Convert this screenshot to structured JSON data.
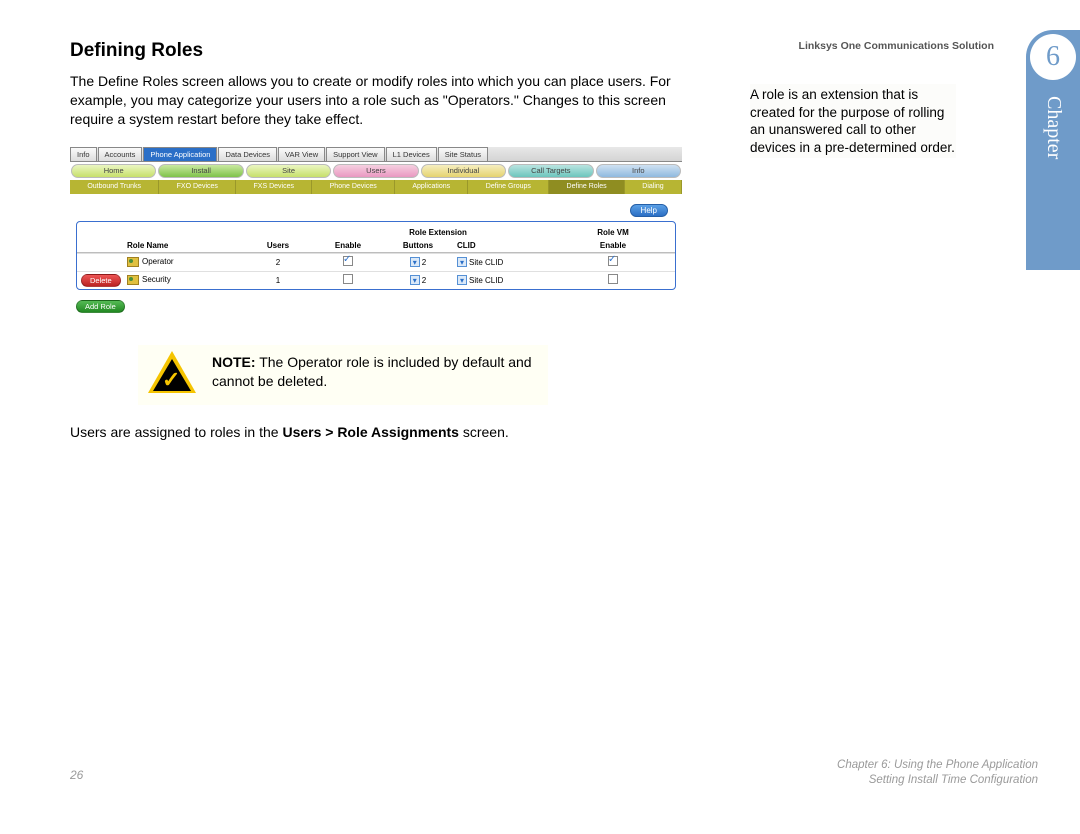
{
  "header": {
    "product": "Linksys One Communications Solution"
  },
  "chapter": {
    "number": "6",
    "label": "Chapter"
  },
  "title": "Defining Roles",
  "intro": "The Define Roles screen allows you to create or modify roles into which you can place users. For example, you may categorize your users into a role such as \"Operators.\" Changes to this screen require a system restart before they take effect.",
  "sideNote": "A role is an extension that is created for the purpose of rolling an unanswered call to other devices in a pre-determined order.",
  "topTabs": [
    "Info",
    "Accounts",
    "Phone Application",
    "Data Devices",
    "VAR View",
    "Support View",
    "L1 Devices",
    "Site Status"
  ],
  "activeTopTab": 2,
  "pillTabs": [
    {
      "label": "Home",
      "cls": "lime"
    },
    {
      "label": "Install",
      "cls": "green"
    },
    {
      "label": "Site",
      "cls": "lime"
    },
    {
      "label": "Users",
      "cls": "pink"
    },
    {
      "label": "Individual",
      "cls": "yellow"
    },
    {
      "label": "Call Targets",
      "cls": "teal"
    },
    {
      "label": "Info",
      "cls": "blue"
    }
  ],
  "subTabs": [
    "Outbound Trunks",
    "FXO Devices",
    "FXS Devices",
    "Phone Devices",
    "Applications",
    "Define Groups",
    "Define Roles",
    "Dialing"
  ],
  "activeSubTab": 6,
  "helpLabel": "Help",
  "table": {
    "groupHeaders": {
      "ext": "Role Extension",
      "vm": "Role VM"
    },
    "columns": {
      "name": "Role Name",
      "users": "Users",
      "enable": "Enable",
      "buttons": "Buttons",
      "clid": "CLID",
      "vmEnable": "Enable"
    },
    "rows": [
      {
        "del": "",
        "name": "Operator",
        "users": "2",
        "enable": true,
        "btn": "2",
        "clid": "Site CLID",
        "vm": true
      },
      {
        "del": "Delete",
        "name": "Security",
        "users": "1",
        "enable": false,
        "btn": "2",
        "clid": "Site CLID",
        "vm": false
      }
    ],
    "addLabel": "Add Role"
  },
  "note": {
    "prefix": "NOTE:",
    "text": " The Operator role is included by default and cannot be deleted."
  },
  "afterNote_a": "Users are assigned to roles in the ",
  "afterNote_b": "Users > Role Assignments",
  "afterNote_c": " screen.",
  "footer": {
    "page": "26",
    "line1": "Chapter 6: Using the Phone Application",
    "line2": "Setting Install Time Configuration"
  }
}
